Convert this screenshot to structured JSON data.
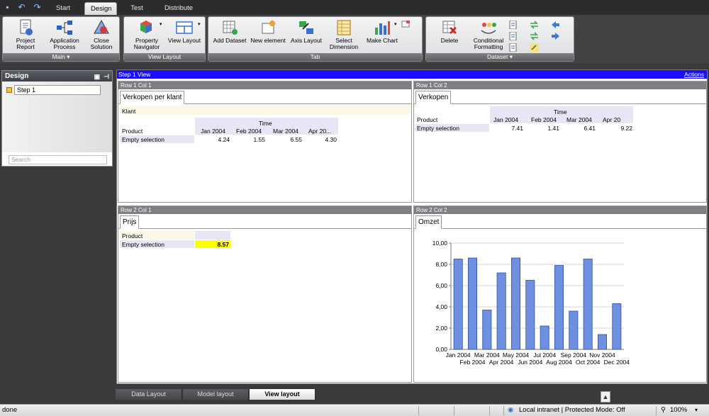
{
  "top_tabs": [
    "Start",
    "Design",
    "Test",
    "Distribute"
  ],
  "ribbon": {
    "main": {
      "label": "Main",
      "buttons": [
        "Project\nReport",
        "Application\nProcess",
        "Close\nSolution"
      ]
    },
    "view_layout": {
      "label": "View Layout",
      "buttons": [
        "Property\nNavigator",
        "View Layout"
      ]
    },
    "tab": {
      "label": "Tab",
      "buttons": [
        "Add Dataset",
        "New element",
        "Axis Layout",
        "Select\nDimension",
        "Make Chart"
      ]
    },
    "dataset": {
      "label": "Dataset",
      "buttons": [
        "Delete",
        "Conditional\nFormatting"
      ]
    }
  },
  "design_panel": {
    "title": "Design",
    "step": "Step 1",
    "search_placeholder": "Search"
  },
  "view": {
    "title": "Step 1 View",
    "actions": "Actions",
    "cells": [
      {
        "header": "Row 1 Col 1",
        "tab": "Verkopen per klant",
        "filter": "Klant",
        "dimension": "Time",
        "row_label": "Product",
        "columns": [
          "Jan 2004",
          "Feb 2004",
          "Mar 2004",
          "Apr 20..."
        ],
        "row_name": "Empty selection",
        "values": [
          "4.24",
          "1.55",
          "6.55",
          "4.30"
        ]
      },
      {
        "header": "Row 1 Col 2",
        "tab": "Verkopen",
        "dimension": "Time",
        "row_label": "Product",
        "columns": [
          "Jan 2004",
          "Feb 2004",
          "Mar 2004",
          "Apr 20"
        ],
        "row_name": "Empty selection",
        "values": [
          "7.41",
          "1.41",
          "6.41",
          "9.22"
        ]
      },
      {
        "header": "Row 2 Col 1",
        "tab": "Prijs",
        "row_label": "Product",
        "row_name": "Empty selection",
        "value": "8.57",
        "value_color": "#ffff00"
      },
      {
        "header": "Row 2 Col 2",
        "tab": "Omzet"
      }
    ]
  },
  "chart_data": {
    "type": "bar",
    "categories": [
      "Jan 2004",
      "Feb 2004",
      "Mar 2004",
      "Apr 2004",
      "May 2004",
      "Jun 2004",
      "Jul 2004",
      "Aug 2004",
      "Sep 2004",
      "Oct 2004",
      "Nov 2004",
      "Dec 2004"
    ],
    "values": [
      8.5,
      8.6,
      3.7,
      7.2,
      8.6,
      6.5,
      2.2,
      7.9,
      3.6,
      8.5,
      1.4,
      4.3
    ],
    "ylim": [
      0,
      10
    ],
    "yticks": [
      "0,00",
      "2,00",
      "4,00",
      "6,00",
      "8,00",
      "10,00"
    ],
    "bar_color": "#6f8fe0",
    "grid": true
  },
  "bottom_tabs": [
    "Data Layout",
    "Model layout",
    "View layout"
  ],
  "status": {
    "left": "done",
    "zone": "Local intranet | Protected Mode: Off",
    "zoom": "100%"
  }
}
